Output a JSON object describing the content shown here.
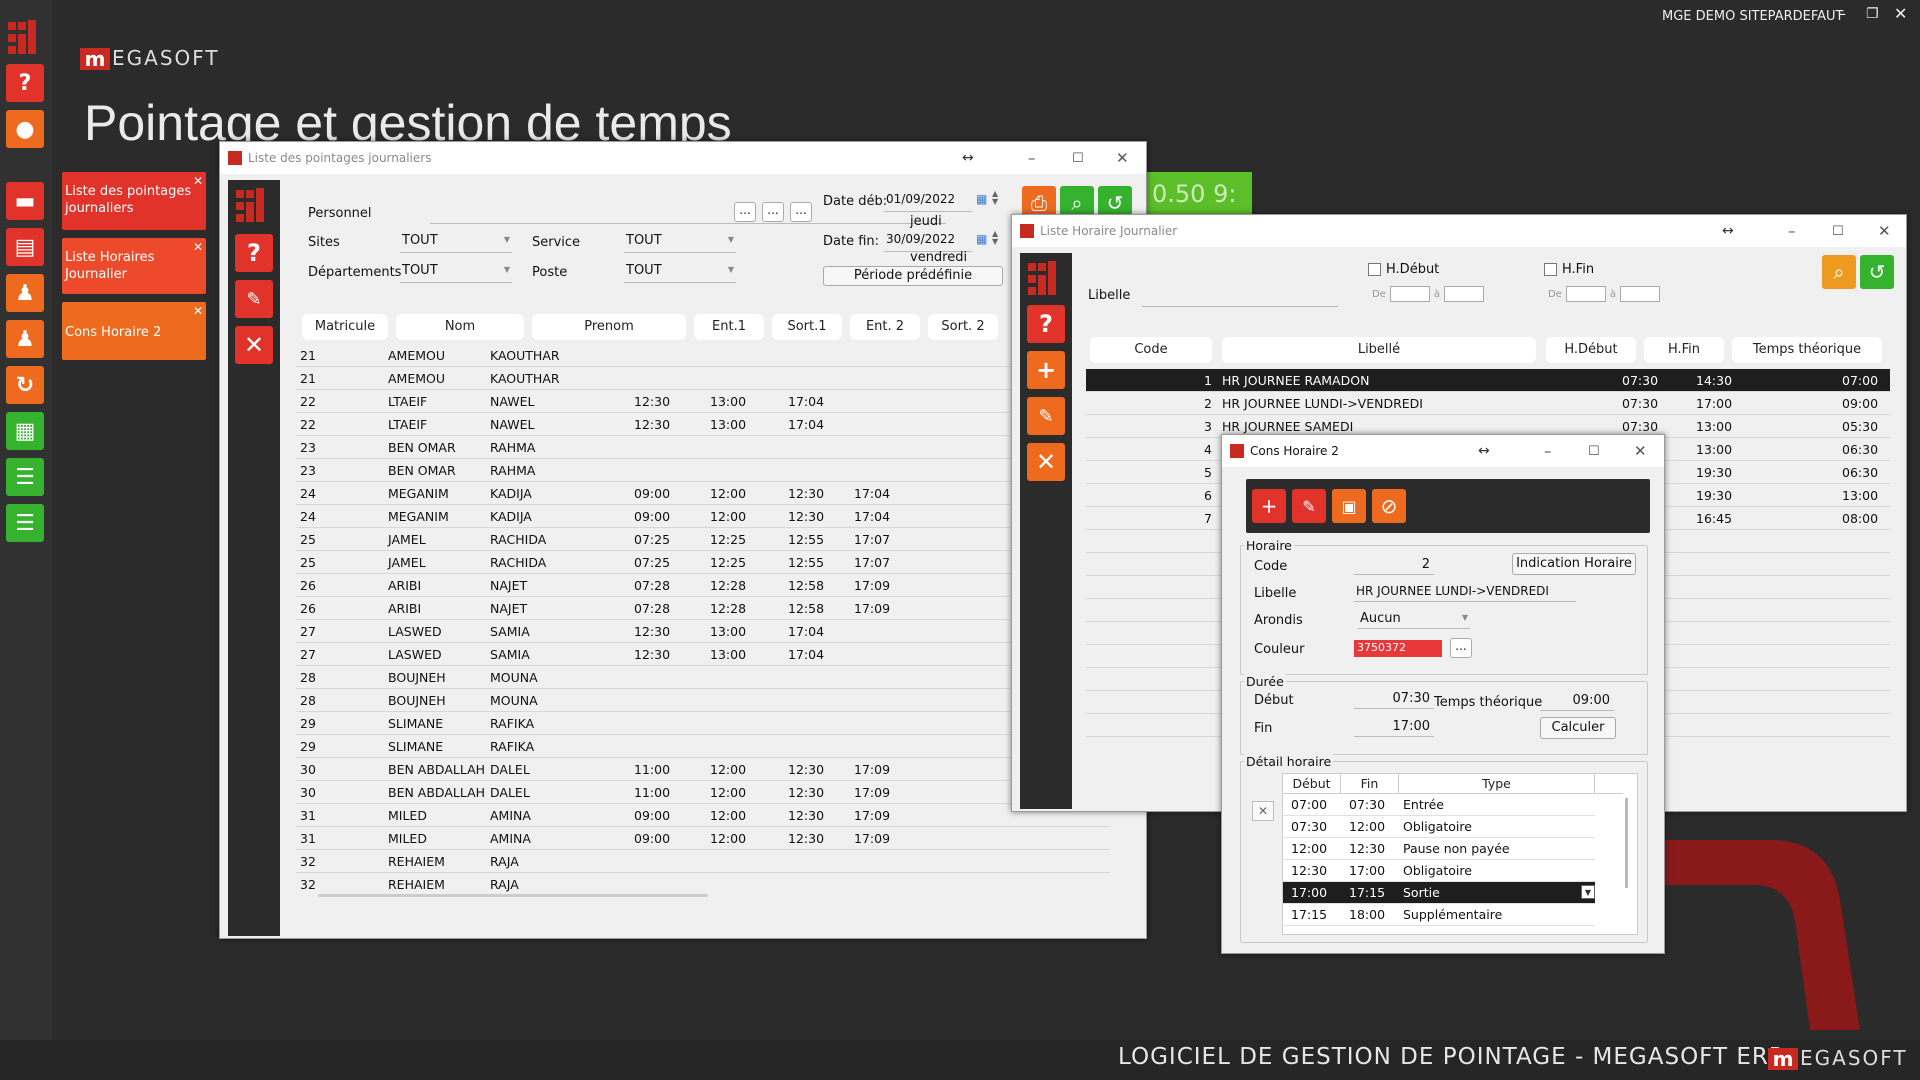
{
  "app": {
    "user": "MGE DEMO SITEPARDEFAUT",
    "title": "Pointage et gestion de temps",
    "footer": "LOGICIEL DE GESTION DE POINTAGE - MEGASOFT ERP",
    "logo_text": "EGASOFT",
    "logo_letter": "m",
    "bg_clock": "0.50 9:"
  },
  "tiles": [
    "Liste des pointages journaliers",
    "Liste Horaires Journalier",
    "Cons Horaire 2"
  ],
  "pointages": {
    "title": "Liste des pointages journaliers",
    "personnel_label": "Personnel",
    "sites_label": "Sites",
    "sites_value": "TOUT",
    "service_label": "Service",
    "service_value": "TOUT",
    "departements_label": "Départements",
    "departements_value": "TOUT",
    "poste_label": "Poste",
    "poste_value": "TOUT",
    "date_deb_label": "Date déb:",
    "date_deb": "01/09/2022",
    "date_deb_day": "jeudi",
    "date_fin_label": "Date fin:",
    "date_fin": "30/09/2022",
    "date_fin_day": "vendredi",
    "periode_button": "Période prédéfinie",
    "ellipsis": "...",
    "columns": [
      "Matricule",
      "Nom",
      "Prenom",
      "Ent.1",
      "Sort.1",
      "Ent. 2",
      "Sort. 2"
    ],
    "rows": [
      [
        "21",
        "AMEMOU",
        "KAOUTHAR",
        "",
        "",
        "",
        ""
      ],
      [
        "21",
        "AMEMOU",
        "KAOUTHAR",
        "",
        "",
        "",
        ""
      ],
      [
        "22",
        "LTAEIF",
        "NAWEL",
        "12:30",
        "13:00",
        "17:04",
        ""
      ],
      [
        "22",
        "LTAEIF",
        "NAWEL",
        "12:30",
        "13:00",
        "17:04",
        ""
      ],
      [
        "23",
        "BEN OMAR",
        "RAHMA",
        "",
        "",
        "",
        ""
      ],
      [
        "23",
        "BEN OMAR",
        "RAHMA",
        "",
        "",
        "",
        ""
      ],
      [
        "24",
        "MEGANIM",
        "KADIJA",
        "09:00",
        "12:00",
        "12:30",
        "17:04"
      ],
      [
        "24",
        "MEGANIM",
        "KADIJA",
        "09:00",
        "12:00",
        "12:30",
        "17:04"
      ],
      [
        "25",
        "JAMEL",
        "RACHIDA",
        "07:25",
        "12:25",
        "12:55",
        "17:07"
      ],
      [
        "25",
        "JAMEL",
        "RACHIDA",
        "07:25",
        "12:25",
        "12:55",
        "17:07"
      ],
      [
        "26",
        "ARIBI",
        "NAJET",
        "07:28",
        "12:28",
        "12:58",
        "17:09"
      ],
      [
        "26",
        "ARIBI",
        "NAJET",
        "07:28",
        "12:28",
        "12:58",
        "17:09"
      ],
      [
        "27",
        "LASWED",
        "SAMIA",
        "12:30",
        "13:00",
        "17:04",
        ""
      ],
      [
        "27",
        "LASWED",
        "SAMIA",
        "12:30",
        "13:00",
        "17:04",
        ""
      ],
      [
        "28",
        "BOUJNEH",
        "MOUNA",
        "",
        "",
        "",
        ""
      ],
      [
        "28",
        "BOUJNEH",
        "MOUNA",
        "",
        "",
        "",
        ""
      ],
      [
        "29",
        "SLIMANE",
        "RAFIKA",
        "",
        "",
        "",
        ""
      ],
      [
        "29",
        "SLIMANE",
        "RAFIKA",
        "",
        "",
        "",
        ""
      ],
      [
        "30",
        "BEN ABDALLAH",
        "DALEL",
        "11:00",
        "12:00",
        "12:30",
        "17:09"
      ],
      [
        "30",
        "BEN ABDALLAH",
        "DALEL",
        "11:00",
        "12:00",
        "12:30",
        "17:09"
      ],
      [
        "31",
        "MILED",
        "AMINA",
        "09:00",
        "12:00",
        "12:30",
        "17:09"
      ],
      [
        "31",
        "MILED",
        "AMINA",
        "09:00",
        "12:00",
        "12:30",
        "17:09"
      ],
      [
        "32",
        "REHAIEM",
        "RAJA",
        "",
        "",
        "",
        ""
      ],
      [
        "32",
        "REHAIEM",
        "RAJA",
        "",
        "",
        "",
        ""
      ]
    ]
  },
  "horaires": {
    "title": "Liste Horaire Journalier",
    "hdebut_label": "H.Début",
    "hfin_label": "H.Fin",
    "de_label": "De",
    "a_label": "à",
    "libelle_label": "Libelle",
    "columns": [
      "Code",
      "Libellé",
      "H.Début",
      "H.Fin",
      "Temps théorique"
    ],
    "rows": [
      [
        "1",
        "HR JOURNEE RAMADON",
        "07:30",
        "14:30",
        "07:00"
      ],
      [
        "2",
        "HR JOURNEE LUNDI->VENDREDI",
        "07:30",
        "17:00",
        "09:00"
      ],
      [
        "3",
        "HR JOURNEE SAMEDI",
        "07:30",
        "13:00",
        "05:30"
      ],
      [
        "4",
        "",
        "",
        "13:00",
        "06:30"
      ],
      [
        "5",
        "",
        "",
        "19:30",
        "06:30"
      ],
      [
        "6",
        "",
        "",
        "19:30",
        "13:00"
      ],
      [
        "7",
        "",
        "",
        "16:45",
        "08:00"
      ]
    ]
  },
  "cons": {
    "title": "Cons Horaire 2",
    "horaire_group": "Horaire",
    "code_label": "Code",
    "code_value": "2",
    "indication_button": "Indication Horaire",
    "libelle_label": "Libelle",
    "libelle_value": "HR JOURNEE LUNDI->VENDREDI",
    "arrondis_label": "Arondis",
    "arrondis_value": "Aucun",
    "couleur_label": "Couleur",
    "couleur_value": "3750372",
    "couleur_color": "#e8383a",
    "duree_group": "Durée",
    "debut_label": "Début",
    "debut_value": "07:30",
    "temps_label": "Temps théorique",
    "temps_value": "09:00",
    "fin_label": "Fin",
    "fin_value": "17:00",
    "calculer_button": "Calculer",
    "detail_group": "Détail horaire",
    "detail_columns": [
      "Début",
      "Fin",
      "Type"
    ],
    "detail_rows": [
      [
        "07:00",
        "07:30",
        "Entrée"
      ],
      [
        "07:30",
        "12:00",
        "Obligatoire"
      ],
      [
        "12:00",
        "12:30",
        "Pause non payée"
      ],
      [
        "12:30",
        "17:00",
        "Obligatoire"
      ],
      [
        "17:00",
        "17:15",
        "Sortie"
      ],
      [
        "17:15",
        "18:00",
        "Supplémentaire"
      ]
    ]
  }
}
